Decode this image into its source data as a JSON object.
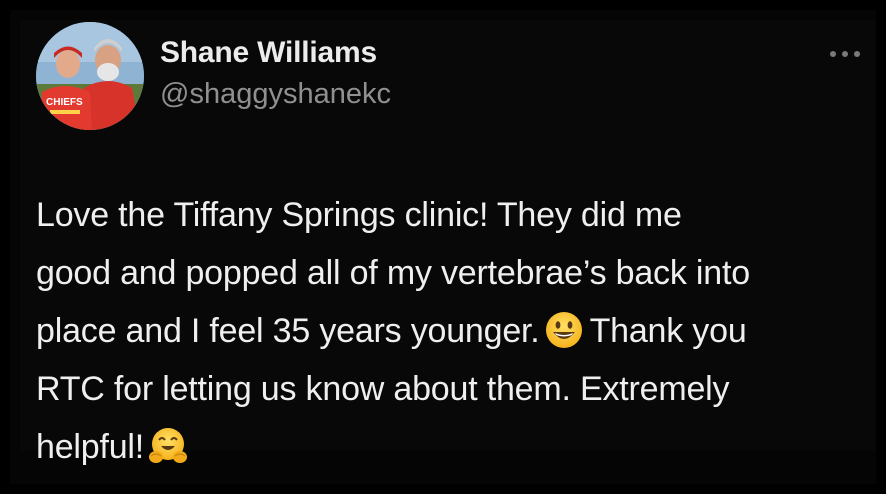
{
  "tweet": {
    "author": {
      "name": "Shane Williams",
      "handle": "@shaggyshanekc",
      "avatar_icon": "profile-photo-two-people-chiefs-shirt"
    },
    "more_icon": "more-horizontal-icon",
    "text_lines": [
      "Love the Tiffany Springs clinic! They did me",
      "good and popped all of my vertebrae’s back into",
      "place and I feel 35 years younger.",
      "Thank you",
      "RTC for letting us know about them. Extremely",
      "helpful!"
    ],
    "emojis": [
      {
        "name": "grinning-face-emoji",
        "after_line": 3
      },
      {
        "name": "hugging-face-emoji",
        "after_line": 6
      }
    ],
    "colors": {
      "background": "#000000",
      "name": "#ececec",
      "handle": "#909090",
      "text": "#efefef",
      "accent_red": "#d8332a"
    }
  }
}
